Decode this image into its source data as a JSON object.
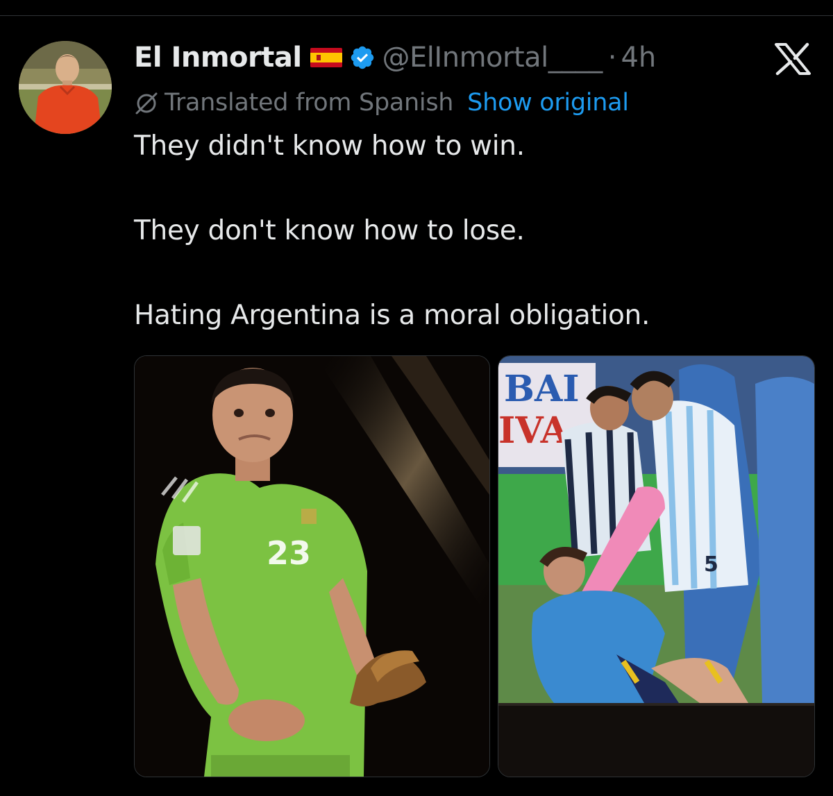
{
  "tweet": {
    "display_name": "El Inmortal",
    "handle": "@ElInmortal____",
    "separator": "·",
    "time": "4h",
    "translation_note": "Translated from Spanish",
    "show_original_label": "Show original",
    "lines": [
      "They didn't know how to win.",
      "They don't know how to lose.",
      "Hating Argentina is a moral obligation."
    ],
    "images": [
      {
        "jersey_number": "23"
      },
      {
        "banner_text_1": "BAI",
        "banner_text_2": "IVA",
        "jersey_number": "5"
      }
    ]
  },
  "icons": {
    "avatar": "avatar",
    "flag": "spain-flag-icon",
    "verified": "verified-badge-icon",
    "close": "x-logo-icon",
    "translate": "globe-strike-icon"
  },
  "colors": {
    "background": "#000000",
    "text_primary": "#e7e9ea",
    "text_secondary": "#71767b",
    "link": "#1d9bf0",
    "verified": "#1d9bf0"
  }
}
